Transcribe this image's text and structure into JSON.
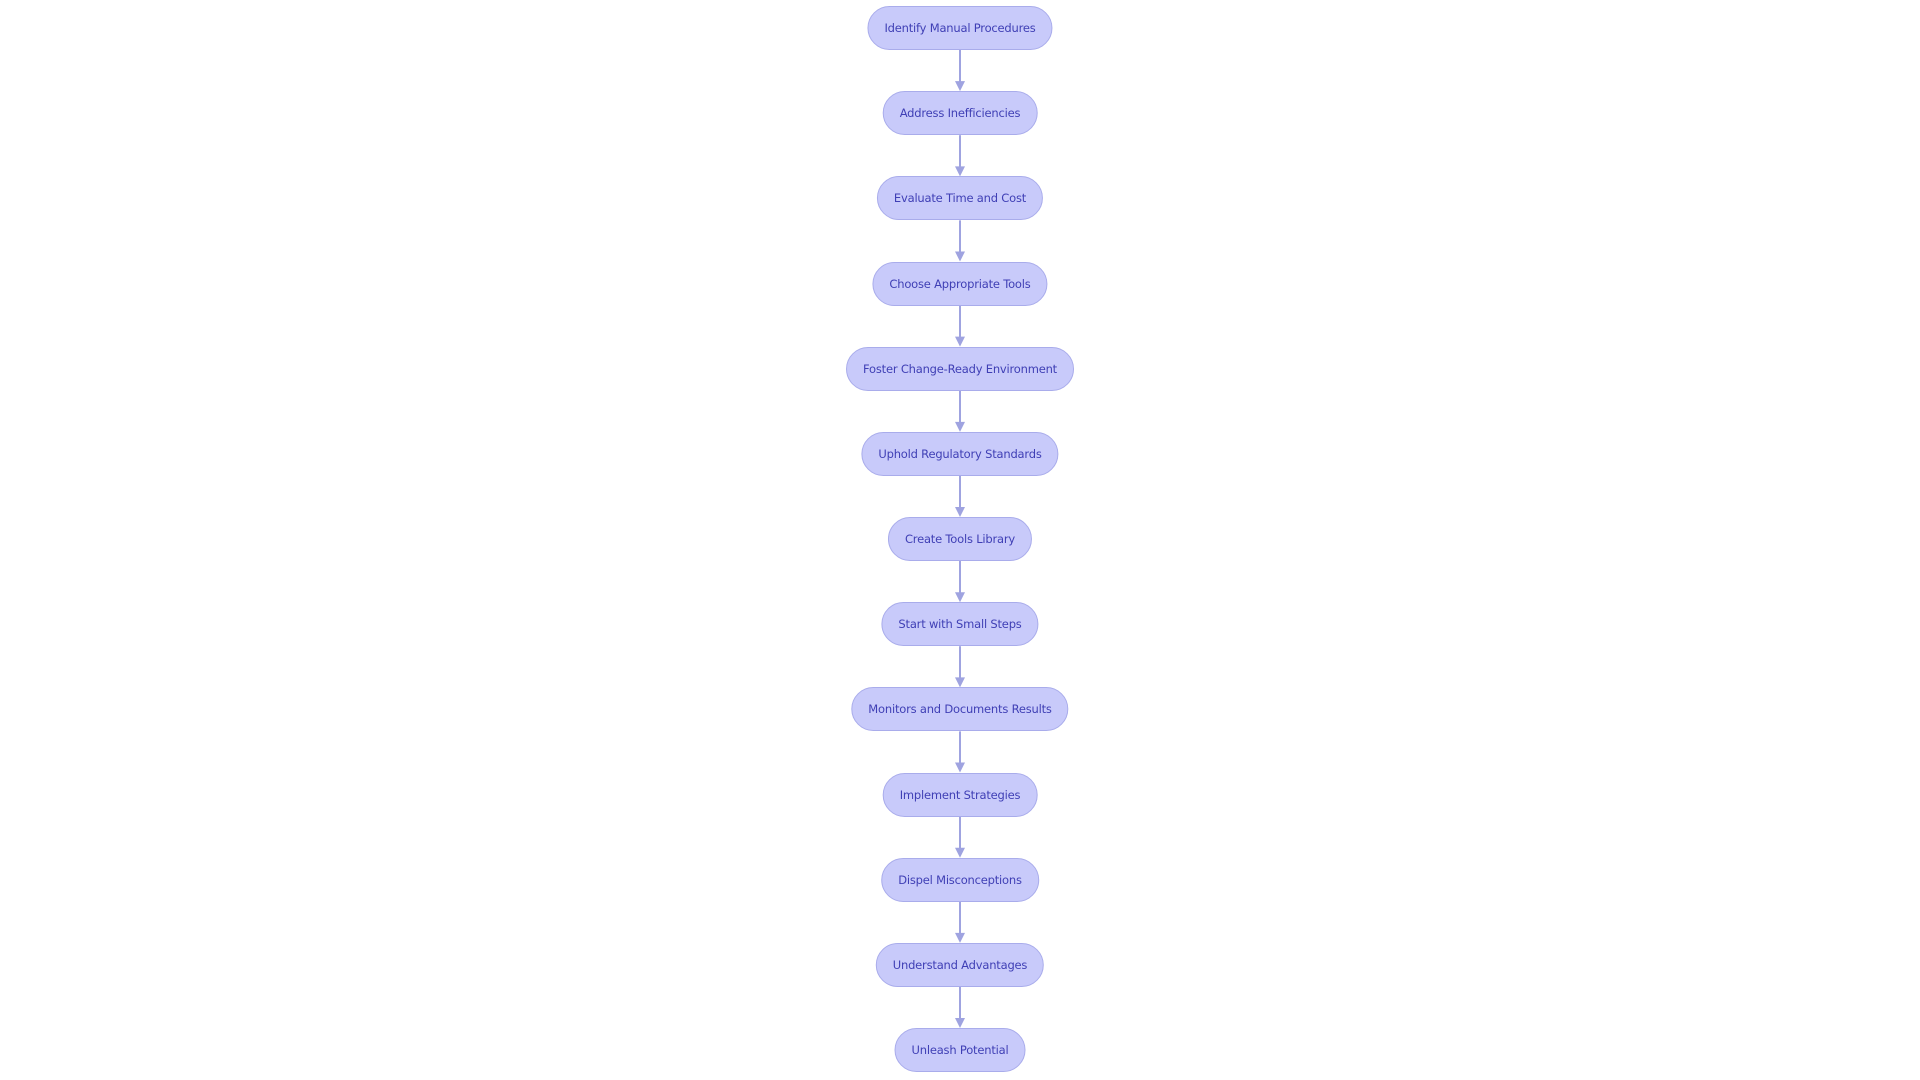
{
  "diagram": {
    "type": "flowchart",
    "direction": "top-to-bottom",
    "colors": {
      "node_fill": "#C8CAFA",
      "node_stroke": "#A9ACEB",
      "node_text": "#3F3FB5",
      "edge": "#9FA3E0"
    },
    "nodes": [
      {
        "id": "n1",
        "label": "Identify Manual Procedures"
      },
      {
        "id": "n2",
        "label": "Address Inefficiencies"
      },
      {
        "id": "n3",
        "label": "Evaluate Time and Cost"
      },
      {
        "id": "n4",
        "label": "Choose Appropriate Tools"
      },
      {
        "id": "n5",
        "label": "Foster Change-Ready Environment"
      },
      {
        "id": "n6",
        "label": "Uphold Regulatory Standards"
      },
      {
        "id": "n7",
        "label": "Create Tools Library"
      },
      {
        "id": "n8",
        "label": "Start with Small Steps"
      },
      {
        "id": "n9",
        "label": "Monitors and Documents Results"
      },
      {
        "id": "n10",
        "label": "Implement Strategies"
      },
      {
        "id": "n11",
        "label": "Dispel Misconceptions"
      },
      {
        "id": "n12",
        "label": "Understand Advantages"
      },
      {
        "id": "n13",
        "label": "Unleash Potential"
      }
    ],
    "edges": [
      {
        "from": "n1",
        "to": "n2"
      },
      {
        "from": "n2",
        "to": "n3"
      },
      {
        "from": "n3",
        "to": "n4"
      },
      {
        "from": "n4",
        "to": "n5"
      },
      {
        "from": "n5",
        "to": "n6"
      },
      {
        "from": "n6",
        "to": "n7"
      },
      {
        "from": "n7",
        "to": "n8"
      },
      {
        "from": "n8",
        "to": "n9"
      },
      {
        "from": "n9",
        "to": "n10"
      },
      {
        "from": "n10",
        "to": "n11"
      },
      {
        "from": "n11",
        "to": "n12"
      },
      {
        "from": "n12",
        "to": "n13"
      }
    ]
  }
}
